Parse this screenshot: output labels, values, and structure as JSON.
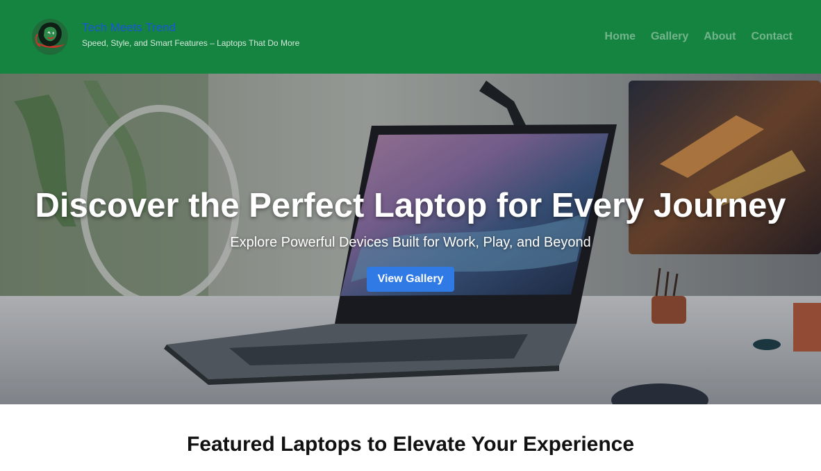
{
  "header": {
    "site_title": "Tech Meets Trend",
    "tagline": "Speed, Style, and Smart Features – Laptops That Do More",
    "logo_icon": "lion-emblem-icon",
    "background_color": "#158441",
    "title_color": "#1a55d6"
  },
  "nav": {
    "items": [
      {
        "label": "Home"
      },
      {
        "label": "Gallery"
      },
      {
        "label": "About"
      },
      {
        "label": "Contact"
      }
    ],
    "link_color": "#74b48c"
  },
  "hero": {
    "title": "Discover the Perfect Laptop for Every Journey",
    "subtitle": "Explore Powerful Devices Built for Work, Play, and Beyond",
    "cta_label": "View Gallery",
    "cta_color": "#2f7ae5"
  },
  "featured": {
    "heading": "Featured Laptops to Elevate Your Experience"
  }
}
